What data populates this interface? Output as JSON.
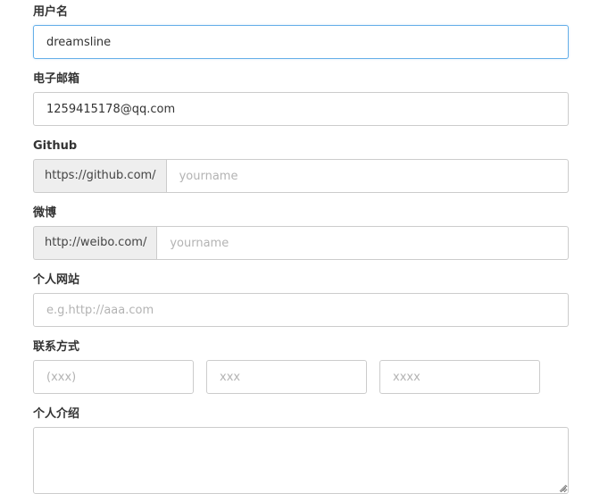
{
  "form": {
    "username": {
      "label": "用户名",
      "value": "dreamsline"
    },
    "email": {
      "label": "电子邮箱",
      "value": "1259415178@qq.com"
    },
    "github": {
      "label": "Github",
      "prefix": "https://github.com/",
      "value": "",
      "placeholder": "yourname"
    },
    "weibo": {
      "label": "微博",
      "prefix": "http://weibo.com/",
      "value": "",
      "placeholder": "yourname"
    },
    "website": {
      "label": "个人网站",
      "value": "",
      "placeholder": "e.g.http://aaa.com"
    },
    "contact": {
      "label": "联系方式",
      "fields": [
        {
          "value": "",
          "placeholder": "(xxx)"
        },
        {
          "value": "",
          "placeholder": "xxx"
        },
        {
          "value": "",
          "placeholder": "xxxx"
        }
      ]
    },
    "bio": {
      "label": "个人介绍",
      "value": ""
    }
  },
  "colors": {
    "focus_border": "#66afe9",
    "border": "#cccccc",
    "addon_bg": "#eeeeee",
    "placeholder": "#b3b3b3"
  }
}
